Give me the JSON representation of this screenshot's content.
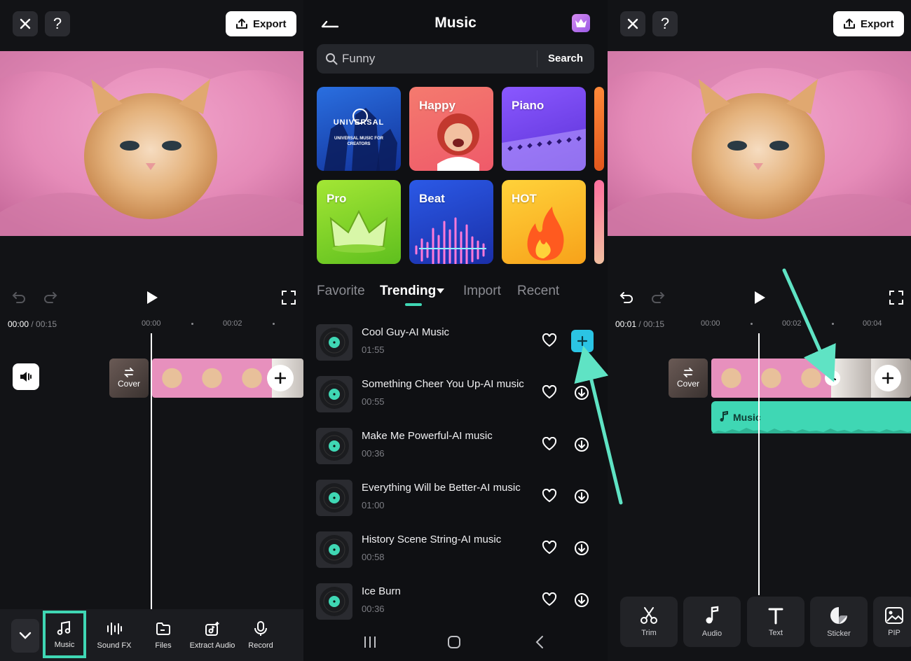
{
  "editor": {
    "export_label": "Export",
    "timeline": {
      "left_current": "00:00",
      "left_total": "/ 00:15",
      "right_current": "00:01",
      "right_total": "/ 00:15",
      "ruler_left": [
        "00:00",
        "00:02"
      ],
      "ruler_right": [
        "00:00",
        "00:02",
        "00:04"
      ],
      "cover_label": "Cover",
      "music_track_label": "Music"
    },
    "toolbar_left": [
      {
        "label": "Music",
        "icon": "music-note-icon"
      },
      {
        "label": "Sound FX",
        "icon": "sound-fx-icon"
      },
      {
        "label": "Files",
        "icon": "folder-icon"
      },
      {
        "label": "Extract Audio",
        "icon": "extract-audio-icon"
      },
      {
        "label": "Record",
        "icon": "microphone-icon"
      }
    ],
    "toolbar_right": [
      {
        "label": "Trim",
        "icon": "scissors-icon"
      },
      {
        "label": "Audio",
        "icon": "music-note-icon"
      },
      {
        "label": "Text",
        "icon": "text-icon"
      },
      {
        "label": "Sticker",
        "icon": "sticker-icon"
      },
      {
        "label": "PIP",
        "icon": "image-icon"
      }
    ]
  },
  "music": {
    "title": "Music",
    "search": {
      "value": "Funny",
      "button": "Search"
    },
    "categories": [
      {
        "label": "",
        "logo_text": "UNIVERSAL",
        "logo_sub": "UNIVERSAL MUSIC FOR CREATORS",
        "color": "#1b4fb8"
      },
      {
        "label": "Happy",
        "color": "#f06a6a"
      },
      {
        "label": "Piano",
        "color": "#7a4df0"
      },
      {
        "label": "Pro",
        "color": "#9ad21e"
      },
      {
        "label": "Beat",
        "color": "#2a55e0"
      },
      {
        "label": "HOT",
        "color": "#f6b21a"
      }
    ],
    "tabs": [
      "Favorite",
      "Trending",
      "Import",
      "Recent"
    ],
    "active_tab": "Trending",
    "tracks": [
      {
        "title": "Cool Guy-AI Music",
        "duration": "01:55"
      },
      {
        "title": "Something Cheer You Up-AI music",
        "duration": "00:55"
      },
      {
        "title": "Make Me Powerful-AI music",
        "duration": "00:36"
      },
      {
        "title": "Everything Will be Better-AI music",
        "duration": "01:00"
      },
      {
        "title": "History Scene String-AI music",
        "duration": "00:58"
      },
      {
        "title": "Ice Burn",
        "duration": "00:36"
      }
    ]
  },
  "colors": {
    "accent": "#3fd7b4",
    "add_button": "#2bc4e4",
    "background": "#121316"
  }
}
